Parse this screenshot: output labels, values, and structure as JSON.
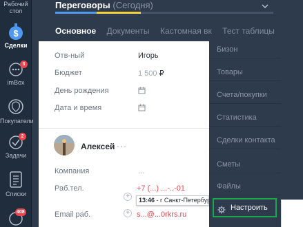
{
  "nav": {
    "items": [
      {
        "label": "Рабочий\nстол",
        "icon": "dashboard-icon"
      },
      {
        "label": "Сделки",
        "icon": "dollar-icon",
        "active": true
      },
      {
        "label": "imBox",
        "icon": "chat-icon",
        "badge": "3"
      },
      {
        "label": "Покупатели",
        "icon": "customers-icon"
      },
      {
        "label": "Задачи",
        "icon": "check-icon",
        "badge": "2"
      },
      {
        "label": "Списки",
        "icon": "list-icon"
      },
      {
        "label": "",
        "icon": "mail-icon",
        "badge": "408"
      }
    ]
  },
  "header": {
    "title": "Переговоры",
    "subtitle": "(Сегодня)",
    "tabs": [
      "Основное",
      "Документы",
      "Кастомная вк",
      "Тест таблицы"
    ],
    "more": "···"
  },
  "card": {
    "fields": [
      {
        "label": "Отв-ный",
        "value": "Игорь"
      },
      {
        "label": "Бюджет",
        "value": "1 500",
        "currency": "₽"
      },
      {
        "label": "День рождения",
        "value": ""
      },
      {
        "label": "Дата и время",
        "value": ""
      }
    ],
    "contact": {
      "name": "Алексей",
      "more": "···",
      "fields": [
        {
          "label": "Компания",
          "value": "..."
        },
        {
          "label": "Раб.тел.",
          "value": "+7 (...) ...-..-01"
        },
        {
          "label": "Email раб.",
          "value": "s...@...0rkrs.ru"
        }
      ]
    },
    "tooltip_time": "13:46",
    "tooltip_text": " - г Санкт-Петербург"
  },
  "menu": {
    "items": [
      "Бизон",
      "Товары",
      "Счета/покупки",
      "Статистика",
      "Сделки контакта",
      "Сметы",
      "Файлы"
    ],
    "settings_label": "Настроить"
  },
  "colors": {
    "sidebar": "#1f2d3d",
    "panel": "#2e3b4d",
    "accent_blue": "#4f9af0",
    "accent_yellow": "#f5d33d",
    "badge_red": "#f0444f",
    "highlight_green": "#19a84a"
  }
}
